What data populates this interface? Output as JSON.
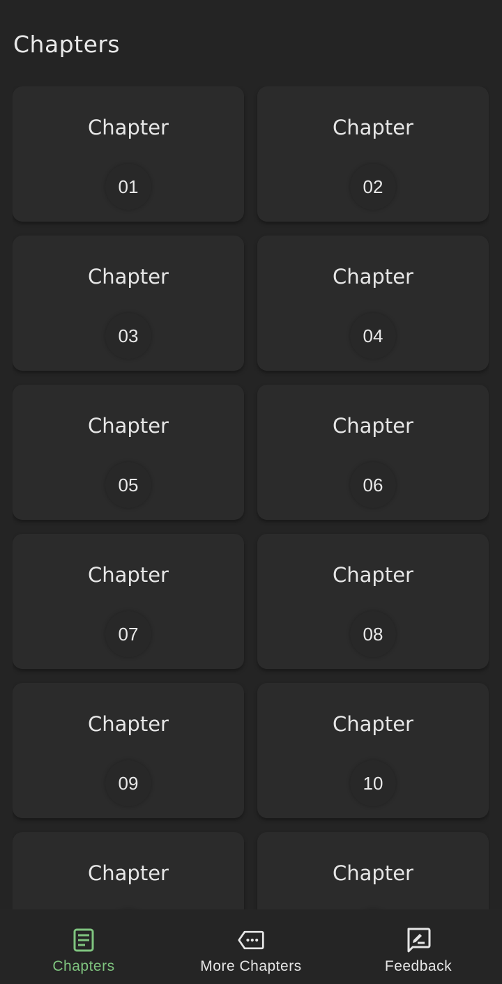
{
  "header": {
    "title": "Chapters"
  },
  "chapters": [
    {
      "label": "Chapter",
      "number": "01"
    },
    {
      "label": "Chapter",
      "number": "02"
    },
    {
      "label": "Chapter",
      "number": "03"
    },
    {
      "label": "Chapter",
      "number": "04"
    },
    {
      "label": "Chapter",
      "number": "05"
    },
    {
      "label": "Chapter",
      "number": "06"
    },
    {
      "label": "Chapter",
      "number": "07"
    },
    {
      "label": "Chapter",
      "number": "08"
    },
    {
      "label": "Chapter",
      "number": "09"
    },
    {
      "label": "Chapter",
      "number": "10"
    },
    {
      "label": "Chapter",
      "number": ""
    },
    {
      "label": "Chapter",
      "number": ""
    }
  ],
  "nav": {
    "active_color": "#7fc47f",
    "items": [
      {
        "label": "Chapters",
        "icon": "article-icon",
        "active": true
      },
      {
        "label": "More Chapters",
        "icon": "more-tag-icon",
        "active": false
      },
      {
        "label": "Feedback",
        "icon": "feedback-icon",
        "active": false
      }
    ]
  }
}
